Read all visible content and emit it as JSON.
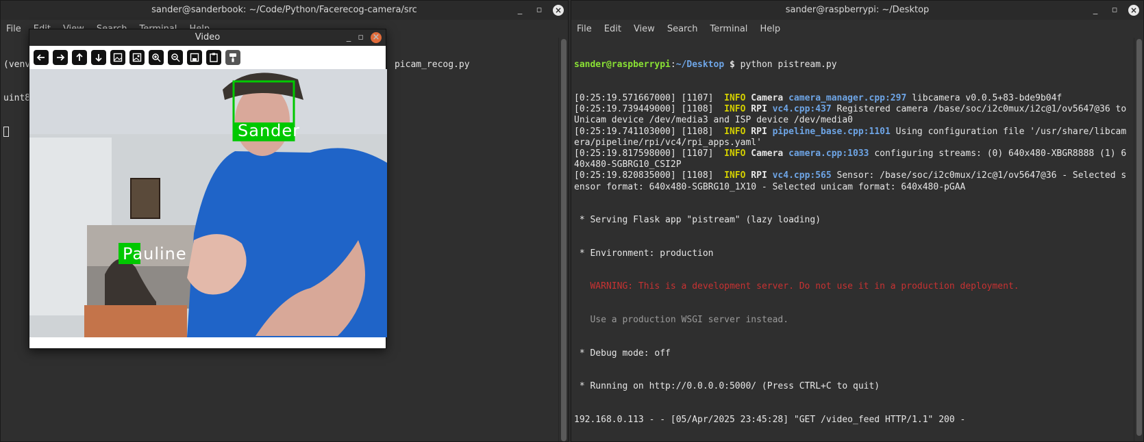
{
  "left_terminal": {
    "title": "sander@sanderbook: ~/Code/Python/Facerecog-camera/src",
    "menu": [
      "File",
      "Edit",
      "View",
      "Search",
      "Terminal",
      "Help"
    ],
    "line1_prefix": "(venv)",
    "line1_suffix": "picam_recog.py",
    "line2_prefix": "uint8"
  },
  "right_terminal": {
    "title": "sander@raspberrypi: ~/Desktop",
    "menu": [
      "File",
      "Edit",
      "View",
      "Search",
      "Terminal",
      "Help"
    ],
    "prompt_user": "sander@raspberrypi",
    "prompt_sep": ":",
    "prompt_path": "~/Desktop",
    "prompt_dollar": "$",
    "command": "python pistream.py",
    "log_lines": [
      {
        "ts": "[0:25:19.571667000] [1107]",
        "level": "INFO",
        "cat": "Camera",
        "src": "camera_manager.cpp:297",
        "msg": "libcamera v0.0.5+83-bde9b04f"
      },
      {
        "ts": "[0:25:19.739449000] [1108]",
        "level": "INFO",
        "cat": "RPI",
        "src": "vc4.cpp:437",
        "msg": "Registered camera /base/soc/i2c0mux/i2c@1/ov5647@36 to Unicam device /dev/media3 and ISP device /dev/media0"
      },
      {
        "ts": "[0:25:19.741103000] [1108]",
        "level": "INFO",
        "cat": "RPI",
        "src": "pipeline_base.cpp:1101",
        "msg": "Using configuration file '/usr/share/libcamera/pipeline/rpi/vc4/rpi_apps.yaml'"
      },
      {
        "ts": "[0:25:19.817598000] [1107]",
        "level": "INFO",
        "cat": "Camera",
        "src": "camera.cpp:1033",
        "msg": "configuring streams: (0) 640x480-XBGR8888 (1) 640x480-SGBRG10_CSI2P"
      },
      {
        "ts": "[0:25:19.820835000] [1108]",
        "level": "INFO",
        "cat": "RPI",
        "src": "vc4.cpp:565",
        "msg": "Sensor: /base/soc/i2c0mux/i2c@1/ov5647@36 - Selected sensor format: 640x480-SGBRG10_1X10 - Selected unicam format: 640x480-pGAA"
      }
    ],
    "flask_serving": " * Serving Flask app \"pistream\" (lazy loading)",
    "flask_env": " * Environment: production",
    "flask_warning": "   WARNING: This is a development server. Do not use it in a production deployment.",
    "flask_wsgi": "   Use a production WSGI server instead.",
    "flask_debug": " * Debug mode: off",
    "flask_running": " * Running on http://0.0.0.0:5000/ (Press CTRL+C to quit)",
    "request_line": "192.168.0.113 - - [05/Apr/2025 23:45:28] \"GET /video_feed HTTP/1.1\" 200 -"
  },
  "video_window": {
    "title": "Video",
    "toolbar_icons": [
      "arrow-left-icon",
      "arrow-right-icon",
      "arrow-up-icon",
      "arrow-down-icon",
      "image-icon",
      "image-settings-icon",
      "zoom-in-icon",
      "zoom-out-icon",
      "save-icon",
      "clipboard-icon",
      "paint-roller-icon"
    ],
    "labels": {
      "face1": "Sander",
      "face2": "Pauline"
    },
    "box_color": "#00c800"
  }
}
